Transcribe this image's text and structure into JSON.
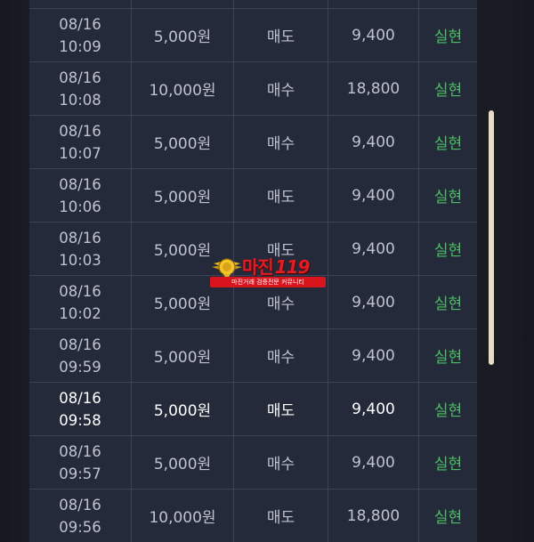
{
  "rows": [
    {
      "date": "08/16",
      "time": "10:09",
      "amount": "5,000원",
      "type": "매도",
      "price": "9,400",
      "result": "실현",
      "highlight": false
    },
    {
      "date": "08/16",
      "time": "10:08",
      "amount": "10,000원",
      "type": "매수",
      "price": "18,800",
      "result": "실현",
      "highlight": false
    },
    {
      "date": "08/16",
      "time": "10:07",
      "amount": "5,000원",
      "type": "매수",
      "price": "9,400",
      "result": "실현",
      "highlight": false
    },
    {
      "date": "08/16",
      "time": "10:06",
      "amount": "5,000원",
      "type": "매도",
      "price": "9,400",
      "result": "실현",
      "highlight": false
    },
    {
      "date": "08/16",
      "time": "10:03",
      "amount": "5,000원",
      "type": "매도",
      "price": "9,400",
      "result": "실현",
      "highlight": false
    },
    {
      "date": "08/16",
      "time": "10:02",
      "amount": "5,000원",
      "type": "매수",
      "price": "9,400",
      "result": "실현",
      "highlight": false
    },
    {
      "date": "08/16",
      "time": "09:59",
      "amount": "5,000원",
      "type": "매수",
      "price": "9,400",
      "result": "실현",
      "highlight": false
    },
    {
      "date": "08/16",
      "time": "09:58",
      "amount": "5,000원",
      "type": "매도",
      "price": "9,400",
      "result": "실현",
      "highlight": true
    },
    {
      "date": "08/16",
      "time": "09:57",
      "amount": "5,000원",
      "type": "매수",
      "price": "9,400",
      "result": "실현",
      "highlight": false
    },
    {
      "date": "08/16",
      "time": "09:56",
      "amount": "10,000원",
      "type": "매도",
      "price": "18,800",
      "result": "실현",
      "highlight": false
    }
  ],
  "watermark": {
    "title": "마진",
    "number": "119",
    "subtitle": "마진거래 검증전문 커뮤니티"
  },
  "colors": {
    "table_bg": "#252a3a",
    "grid_line": "#3c4257",
    "text": "#bfc3cf",
    "result_green": "#4cbf63",
    "scroll_thumb": "#e7dcc5",
    "watermark_red": "#e31b23"
  },
  "icons": {
    "watermark_badge": "winged-emblem-icon"
  }
}
